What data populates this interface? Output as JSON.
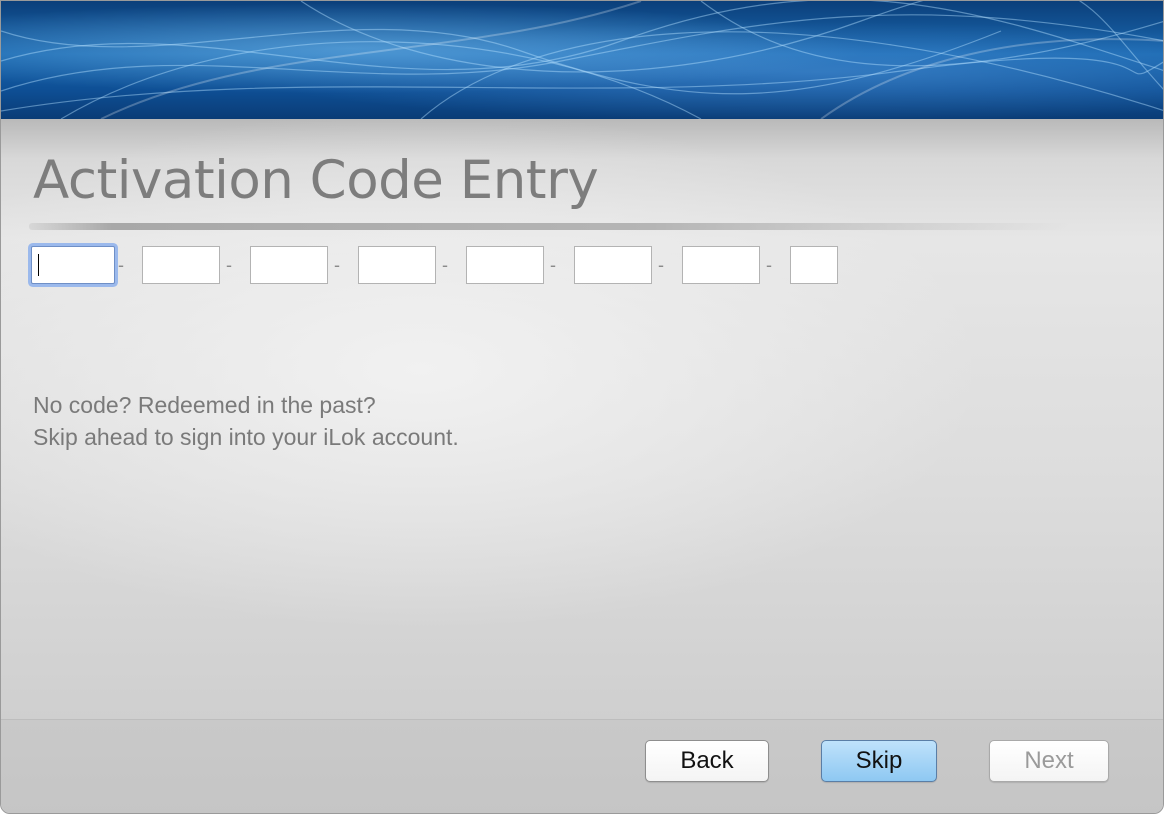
{
  "window": {
    "title": "Activation Code Entry"
  },
  "code_fields": {
    "segments": [
      "",
      "",
      "",
      "",
      "",
      "",
      "",
      ""
    ],
    "separator": "-",
    "focused_index": 0
  },
  "help": {
    "line1": "No code? Redeemed in the past?",
    "line2": "Skip ahead to sign into your iLok account."
  },
  "buttons": {
    "back_label": "Back",
    "skip_label": "Skip",
    "next_label": "Next",
    "next_enabled": false,
    "default_button": "Skip"
  },
  "colors": {
    "banner_blue": "#0e4f95",
    "focus_ring": "#9bb9ec",
    "primary_button": "#8ec8f2",
    "title_gray": "#7d7d7d"
  }
}
